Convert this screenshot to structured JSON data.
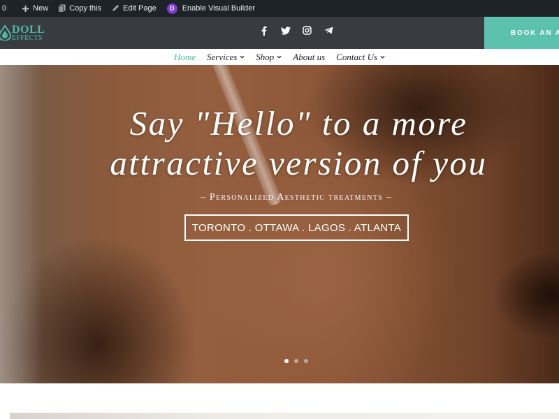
{
  "admin_bar": {
    "comments_count": "0",
    "new_label": "New",
    "copy_label": "Copy this",
    "edit_label": "Edit Page",
    "divi_letter": "D",
    "visual_builder_label": "Enable Visual Builder"
  },
  "header": {
    "logo_main": "DOLL",
    "logo_sub": "EFFECTS",
    "social_icons": [
      "facebook-icon",
      "twitter-icon",
      "instagram-icon",
      "telegram-icon"
    ],
    "book_button": "BOOK AN AP",
    "accent_color": "#5cc1ad",
    "bar_color": "#383b40"
  },
  "nav": {
    "items": [
      {
        "label": "Home",
        "active": true
      },
      {
        "label": "Services",
        "dropdown": true
      },
      {
        "label": "Shop",
        "dropdown": true
      },
      {
        "label": "About us"
      },
      {
        "label": "Contact Us",
        "dropdown": true
      }
    ]
  },
  "hero": {
    "title_line1": "Say \"Hello\" to a more",
    "title_line2": "attractive version of you",
    "subtitle": "– Personalized Aesthetic treatments –",
    "locations_button": "TORONTO . OTTAWA . LAGOS . ATLANTA",
    "slide_count": 3,
    "active_slide": 1
  }
}
